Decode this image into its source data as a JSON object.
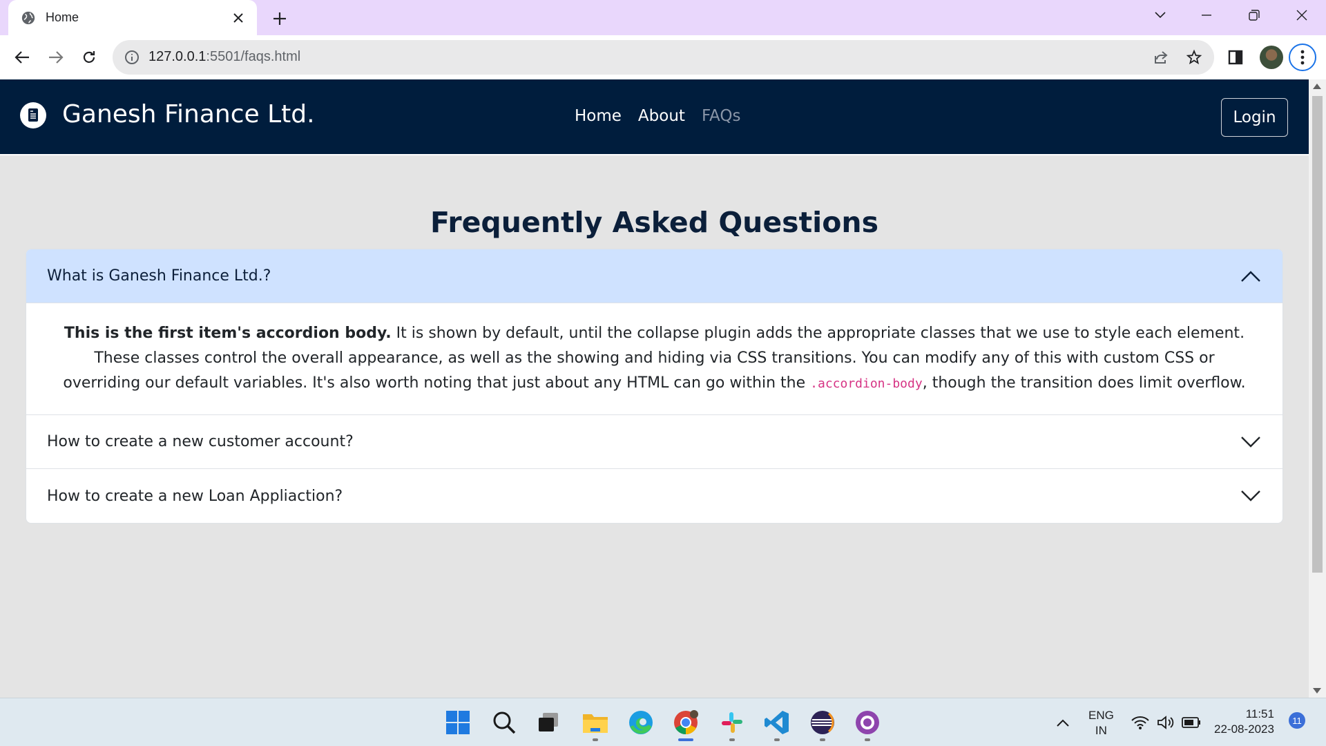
{
  "browser": {
    "tab": {
      "title": "Home"
    },
    "url": {
      "host": "127.0.0.1",
      "path": ":5501/faqs.html"
    }
  },
  "page": {
    "brand": "Ganesh Finance Ltd.",
    "nav": [
      {
        "label": "Home",
        "active": false
      },
      {
        "label": "About",
        "active": false
      },
      {
        "label": "FAQs",
        "active": true
      }
    ],
    "login_label": "Login",
    "heading": "Frequently Asked Questions",
    "faqs": [
      {
        "question": "What is Ganesh Finance Ltd.?",
        "expanded": true,
        "answer": {
          "strong": "This is the first item's accordion body.",
          "text_before_code": " It is shown by default, until the collapse plugin adds the appropriate classes that we use to style each element. These classes control the overall appearance, as well as the showing and hiding via CSS transitions. You can modify any of this with custom CSS or overriding our default variables. It's also worth noting that just about any HTML can go within the ",
          "code": ".accordion-body",
          "text_after_code": ", though the transition does limit overflow."
        }
      },
      {
        "question": "How to create a new customer account?",
        "expanded": false
      },
      {
        "question": "How to create a new Loan Appliaction?",
        "expanded": false
      }
    ]
  },
  "taskbar": {
    "apps": [
      "windows-start-icon",
      "search-icon",
      "task-view-icon",
      "file-explorer-icon",
      "edge-icon",
      "chrome-icon",
      "slack-icon",
      "vscode-icon",
      "eclipse-icon",
      "github-desktop-icon"
    ],
    "lang_line1": "ENG",
    "lang_line2": "IN",
    "time": "11:51",
    "date": "22-08-2023",
    "notification_count": "11"
  },
  "colors": {
    "tab_strip": "#e9d7fc",
    "navbar": "#001d3d",
    "accordion_open": "#cfe2ff",
    "code": "#d63384"
  }
}
